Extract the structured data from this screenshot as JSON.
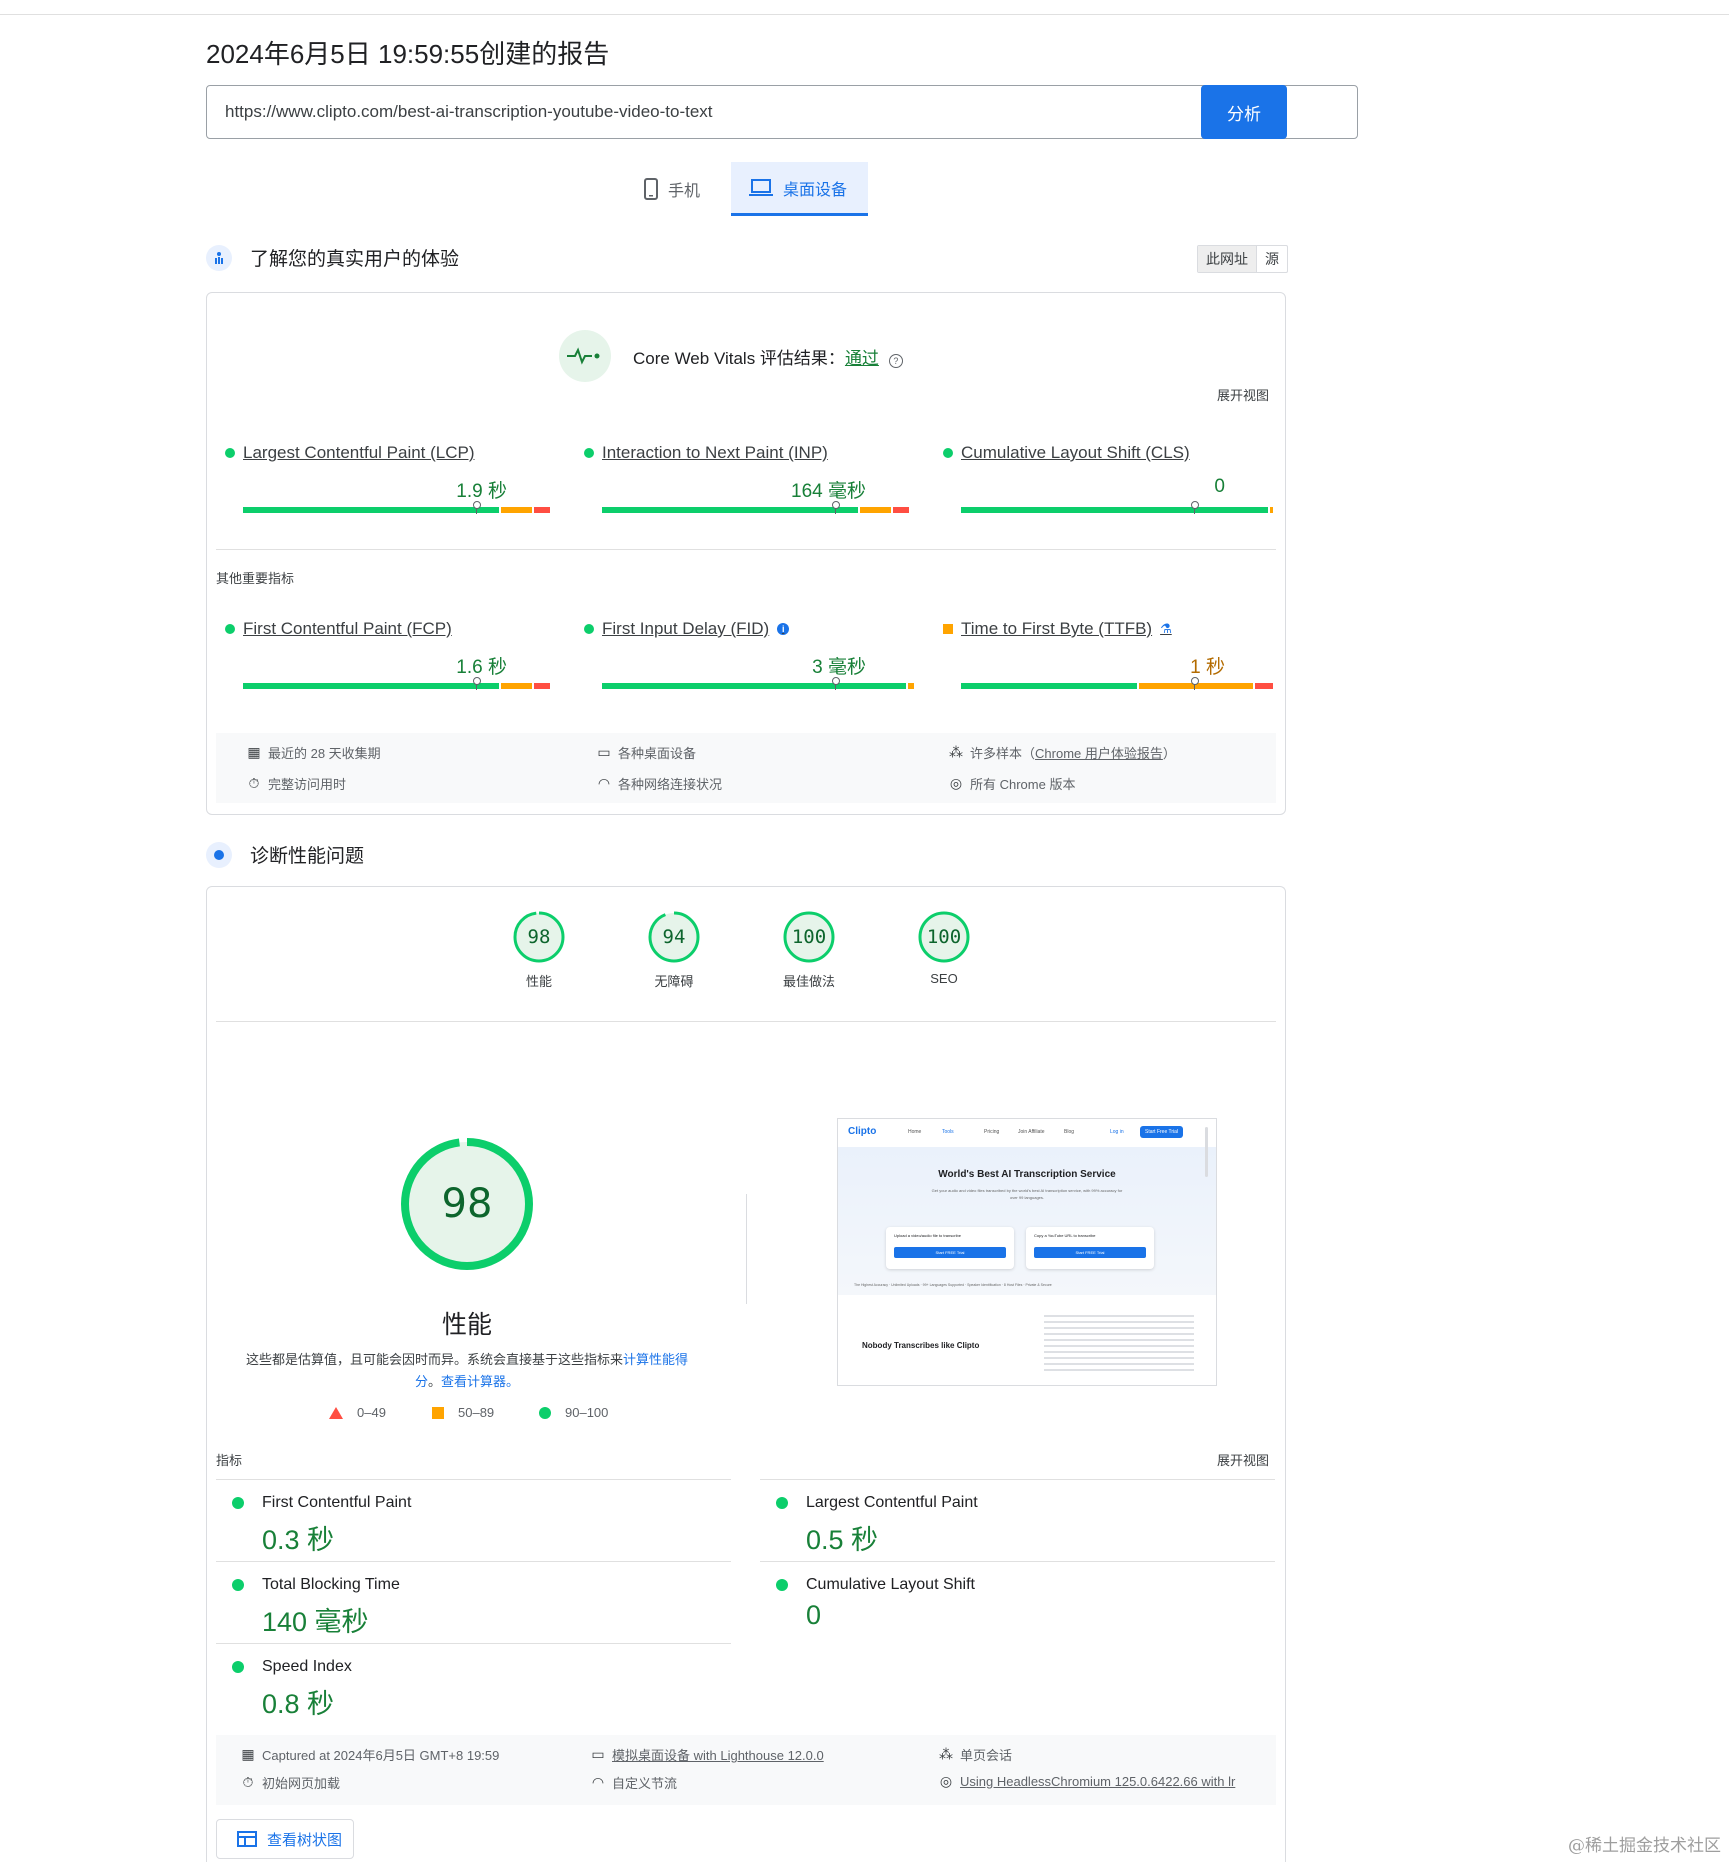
{
  "header": {
    "report_title": "2024年6月5日 19:59:55创建的报告",
    "url_value": "https://www.clipto.com/best-ai-transcription-youtube-video-to-text",
    "analyze_label": "分析"
  },
  "device_tabs": [
    {
      "label": "手机",
      "icon": "phone-icon",
      "selected": false
    },
    {
      "label": "桌面设备",
      "icon": "laptop-icon",
      "selected": true
    }
  ],
  "field_section": {
    "title": "了解您的真实用户的体验",
    "toggle": [
      "此网址",
      "源"
    ],
    "cwv_label": "Core Web Vitals 评估结果：",
    "cwv_status": "通过",
    "expand_label": "展开视图",
    "core_metrics": [
      {
        "name": "Largest Contentful Paint (LCP)",
        "value": "1.9 秒",
        "rating": "good",
        "marker": 0.75
      },
      {
        "name": "Interaction to Next Paint (INP)",
        "value": "164 毫秒",
        "rating": "good",
        "marker": 0.75
      },
      {
        "name": "Cumulative Layout Shift (CLS)",
        "value": "0",
        "rating": "good",
        "marker": 0.75
      }
    ],
    "other_label": "其他重要指标",
    "other_metrics": [
      {
        "name": "First Contentful Paint (FCP)",
        "value": "1.6 秒",
        "rating": "good",
        "marker": 0.75
      },
      {
        "name": "First Input Delay (FID)",
        "value": "3 毫秒",
        "rating": "good",
        "marker": 0.75
      },
      {
        "name": "Time to First Byte (TTFB)",
        "value": "1 秒",
        "rating": "average",
        "marker": 0.75
      }
    ],
    "footer": {
      "period": "最近的 28 天收集期",
      "devices": "各种桌面设备",
      "samples_prefix": "许多样本（",
      "samples_link": "Chrome 用户体验报告",
      "samples_suffix": "）",
      "duration": "完整访问用时",
      "network": "各种网络连接状况",
      "chrome": "所有 Chrome 版本"
    }
  },
  "diag_section": {
    "title": "诊断性能问题",
    "scores": [
      {
        "value": 98,
        "label": "性能"
      },
      {
        "value": 94,
        "label": "无障碍"
      },
      {
        "value": 100,
        "label": "最佳做法"
      },
      {
        "value": 100,
        "label": "SEO"
      }
    ],
    "performance": {
      "value": 98,
      "title": "性能",
      "desc_text": "这些都是估算值，且可能会因时而异。系统会直接基于这些指标来",
      "desc_link1": "计算性能得分",
      "desc_mid": "。",
      "desc_link2": "查看计算器。"
    },
    "legend": [
      "0–49",
      "50–89",
      "90–100"
    ],
    "screenshot": {
      "logo": "Clipto",
      "nav": [
        "Home",
        "Tools",
        "Pricing",
        "Join Affiliate",
        "Blog"
      ],
      "login": "Log in",
      "cta": "Start Free Trial",
      "headline": "World's Best AI Transcription Service",
      "sub": "Get your audio and video files transcribed by the world's best AI transcription service, with 99% accuracy for over 99 languages.",
      "upload_label": "Upload a video/audio file to transcribe",
      "youtube_label": "Copy a YouTube URL to transcribe",
      "btn1": "Start FREE Trial",
      "btn2": "Start FREE Trial",
      "features": "The Highest Accuracy · Unlimited Uploads · 99+ Languages Supported · Speaker Identification · 8 Host Files · Private & Secure",
      "section_title": "Nobody Transcribes like Clipto"
    },
    "metrics_label": "指标",
    "expand_label": "展开视图",
    "lab_metrics": [
      {
        "name": "First Contentful Paint",
        "value": "0.3 秒"
      },
      {
        "name": "Largest Contentful Paint",
        "value": "0.5 秒"
      },
      {
        "name": "Total Blocking Time",
        "value": "140 毫秒"
      },
      {
        "name": "Cumulative Layout Shift",
        "value": "0"
      },
      {
        "name": "Speed Index",
        "value": "0.8 秒"
      }
    ],
    "footer": {
      "captured": "Captured at 2024年6月5日 GMT+8 19:59",
      "emulated": "模拟桌面设备 with Lighthouse 12.0.0",
      "session": "单页会话",
      "initial": "初始网页加载",
      "throttle": "自定义节流",
      "browser": "Using HeadlessChromium 125.0.6422.66 with lr"
    },
    "tree_label": "查看树状图"
  },
  "watermark": "@稀土掘金技术社区",
  "colors": {
    "good": "#0cce6b",
    "average": "#ffa400",
    "poor": "#ff4e42",
    "accent": "#1a73e8"
  }
}
